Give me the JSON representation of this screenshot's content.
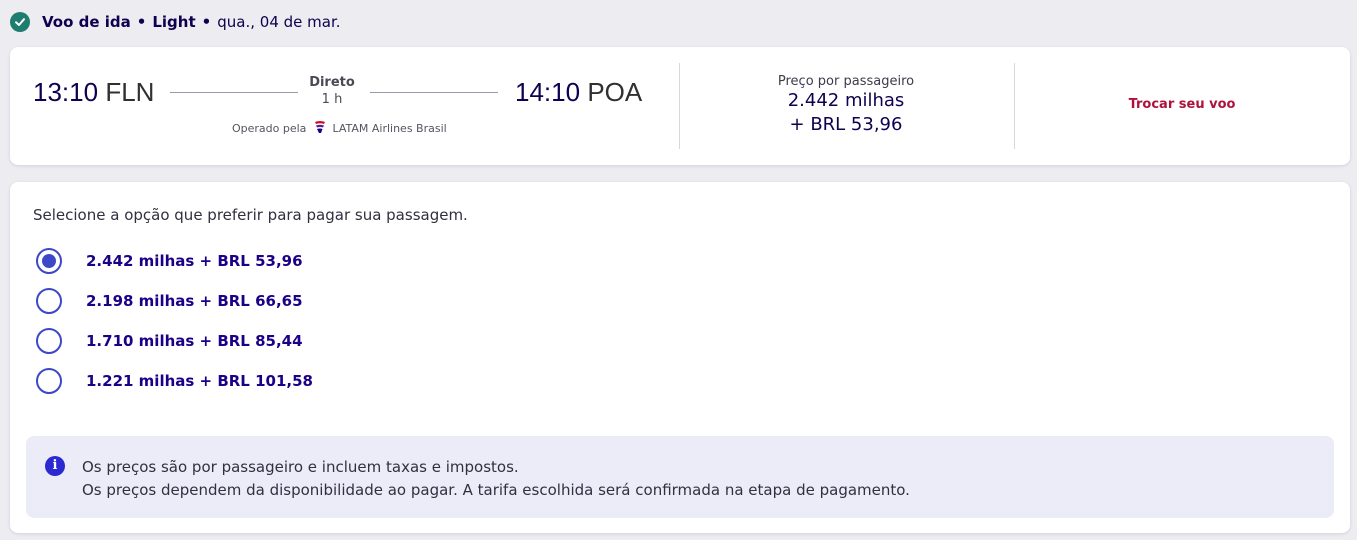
{
  "header": {
    "title": "Voo de ida",
    "fare": "Light",
    "date": "qua., 04 de mar."
  },
  "flight": {
    "departure_time": "13:10",
    "departure_code": "FLN",
    "arrival_time": "14:10",
    "arrival_code": "POA",
    "type": "Direto",
    "duration": "1 h",
    "operated_by_label": "Operado pela",
    "airline": "LATAM Airlines Brasil",
    "price_label": "Preço por passageiro",
    "price_miles": "2.442 milhas",
    "price_cash": "+ BRL 53,96",
    "change_label": "Trocar seu voo"
  },
  "payment": {
    "prompt": "Selecione a opção que preferir para pagar sua passagem.",
    "options": [
      {
        "label": "2.442 milhas + BRL 53,96",
        "selected": true
      },
      {
        "label": "2.198 milhas + BRL 66,65",
        "selected": false
      },
      {
        "label": "1.710 milhas + BRL 85,44",
        "selected": false
      },
      {
        "label": "1.221 milhas + BRL 101,58",
        "selected": false
      }
    ],
    "info_line1": "Os preços são por passageiro e incluem taxas e impostos.",
    "info_line2": "Os preços dependem da disponibilidade ao pagar. A tarifa escolhida será confirmada na etapa de pagamento."
  },
  "colors": {
    "accent": "#1b0088",
    "radio": "#3d48c9",
    "change": "#b0113c",
    "check": "#1e7d6f"
  },
  "icons": {
    "check": "check-circle-icon",
    "airline": "latam-logo-icon",
    "info": "info-icon"
  }
}
